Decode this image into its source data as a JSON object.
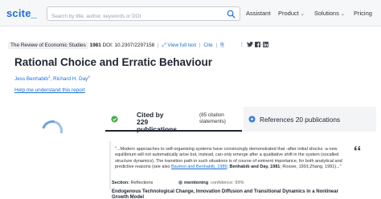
{
  "header": {
    "logo": "scite_",
    "search_placeholder": "Search by title, author, keywords or DOI",
    "nav": {
      "assistant": "Assistant",
      "product": "Product",
      "solutions": "Solutions",
      "pricing": "Pricing"
    }
  },
  "article": {
    "journal": "The Review of Economic Studies",
    "year": "1981",
    "doi": "DOI: 10.2307/2297158",
    "view_full_text": "View full text",
    "cite": "Cite",
    "title": "Rational Choice and Erratic Behaviour",
    "authors": [
      {
        "name": "Jess Benhabib",
        "sup": "1"
      },
      {
        "name": "Richard H. Day",
        "sup": "2"
      }
    ],
    "help_link": "Help me understand this report"
  },
  "tabs": {
    "cited_count": "Cited by 229 publications",
    "cited_sub": "(85 citation statements)",
    "references": "References 20 publications"
  },
  "citation": {
    "quote_pre": "\"...Modern approaches to self-organising systems have convincingly demonstrated that -after initial shocks -a new equilibrium will not automatically arise but, instead, can only emerge after a qualitative shift in the system (socalled structure dynamics). The transition path in such situations is of course of eminent importance, for both analytical and predictive reasons (see also ",
    "quote_link1": "Baumol and Benhabib, 1989",
    "quote_mid": "; ",
    "quote_bold": "Benhabib and Day, 1981",
    "quote_post": "; Rosser, 1991;Zhang, 1991)...\"",
    "section_label": "Section:",
    "section_value": "Reflections",
    "mention_label": "mentioning",
    "confidence": "confidence: 99%",
    "next_title": "Endogenous Technological Change, Innovation Diffusion and Transitional Dynamics in a Nonlinear Growth Model"
  },
  "colors": {
    "brand_blue": "#1a6fd6",
    "cited_green": "#3fae49",
    "refs_blue": "#3d7fd4"
  }
}
